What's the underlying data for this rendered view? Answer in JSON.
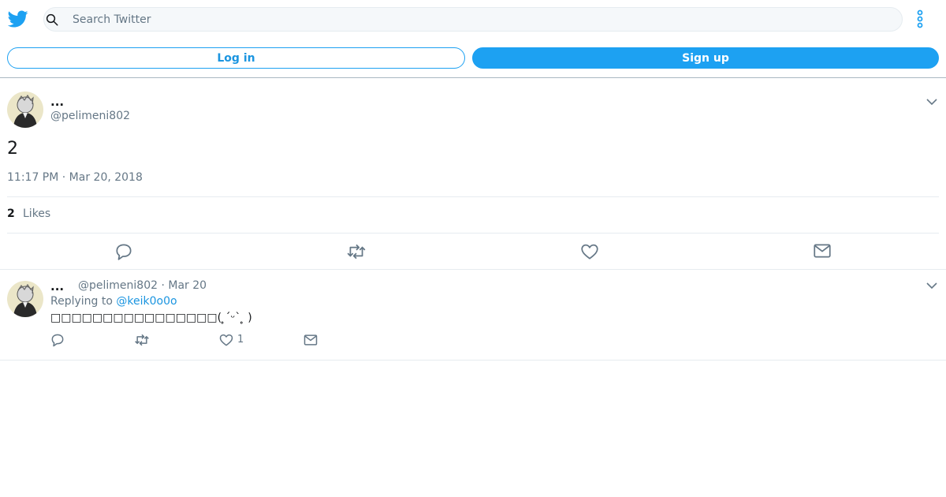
{
  "search": {
    "placeholder": "Search Twitter"
  },
  "auth": {
    "login_label": "Log in",
    "signup_label": "Sign up"
  },
  "tweet": {
    "name": "...",
    "handle": "@pelimeni802",
    "text": "2",
    "timestamp": "11:17 PM · Mar 20, 2018",
    "likes_count": "2",
    "likes_label": "Likes"
  },
  "reply": {
    "name": "...",
    "handle_date": "@pelimeni802 · Mar 20",
    "replying_prefix": "Replying to ",
    "replying_to": "@keik0o0o",
    "text": "□□□□□□□□□□□□□□□□( ̥ˊᵕˋ ̥ )",
    "like_count": "1"
  },
  "colors": {
    "accent": "#1da1f2",
    "link": "#1b95e0",
    "muted": "#657786",
    "text": "#14171a"
  },
  "icons": [
    "twitter-bird-icon",
    "search-icon",
    "more-vertical-icon",
    "chevron-down-icon",
    "reply-icon",
    "retweet-icon",
    "like-icon",
    "dm-icon"
  ]
}
